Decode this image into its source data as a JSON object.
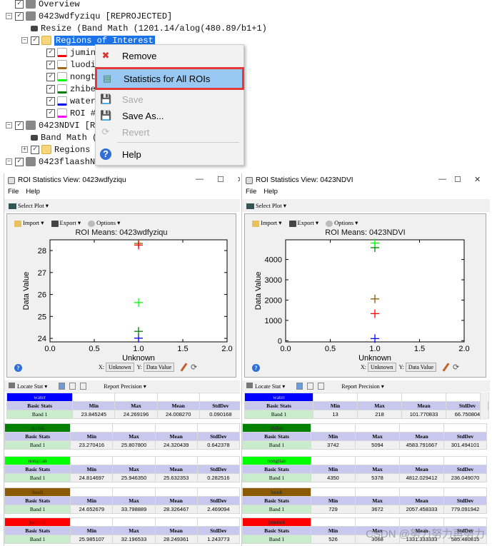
{
  "tree": {
    "items": [
      {
        "label": "Overview",
        "indent": 0,
        "icon": "raster-icon",
        "expander": "",
        "checked": true
      },
      {
        "label": "0423wdfyziqu [REPROJECTED]",
        "indent": 0,
        "icon": "raster-icon",
        "expander": "-",
        "checked": true
      },
      {
        "label": "Resize (Band Math (1201.14/alog(480.89/b1+1)",
        "indent": 1,
        "icon": "band-icon",
        "expander": "",
        "checked": false
      },
      {
        "label": "Regions of Interest",
        "indent": 1,
        "icon": "folder-icon",
        "expander": "-",
        "checked": true,
        "selected": true
      },
      {
        "label": "jumindi",
        "indent": 2,
        "icon": "roi-icon",
        "color": "#ff0000",
        "checked": true
      },
      {
        "label": "luodi",
        "indent": 2,
        "icon": "roi-icon",
        "color": "#a0661a",
        "checked": true
      },
      {
        "label": "nongtian",
        "indent": 2,
        "icon": "roi-icon",
        "color": "#00ff00",
        "checked": true
      },
      {
        "label": "zhibei",
        "indent": 2,
        "icon": "roi-icon",
        "color": "#008000",
        "checked": true
      },
      {
        "label": "water",
        "indent": 2,
        "icon": "roi-icon",
        "color": "#0000ff",
        "checked": true
      },
      {
        "label": "ROI #",
        "indent": 2,
        "icon": "roi-icon",
        "color": "#ff00ff",
        "checked": true
      },
      {
        "label": "0423NDVI [R",
        "indent": 0,
        "icon": "raster-icon",
        "expander": "-",
        "checked": true
      },
      {
        "label": "Band Math (",
        "indent": 1,
        "icon": "band-icon",
        "expander": "",
        "checked": false
      },
      {
        "label": "Regions",
        "indent": 1,
        "icon": "folder-icon",
        "expander": "+",
        "checked": true
      },
      {
        "label": "0423flaashN",
        "indent": 0,
        "icon": "raster-icon",
        "expander": "-",
        "checked": true
      }
    ]
  },
  "context_menu": {
    "items": [
      {
        "label": "Remove",
        "icon": "remove-icon",
        "disabled": false
      },
      {
        "label": "Statistics for All ROIs",
        "icon": "statistics-icon",
        "disabled": false,
        "highlighted": true
      },
      {
        "label": "Save",
        "icon": "save-icon",
        "disabled": true
      },
      {
        "label": "Save As...",
        "icon": "save-as-icon",
        "disabled": false
      },
      {
        "label": "Revert",
        "icon": "revert-icon",
        "disabled": true
      },
      {
        "label": "Help",
        "icon": "help-icon",
        "disabled": false
      }
    ],
    "highlight_color": "#e53935"
  },
  "windows": [
    {
      "title": "ROI Statistics View: 0423wdfyziqu",
      "menu": [
        "File",
        "Help"
      ],
      "select_plot": "Select Plot",
      "plot_toolbar": [
        "Import",
        "Export",
        "Options"
      ],
      "x_select": "Unknown",
      "y_select": "Data Value",
      "x_label_prefix": "X:",
      "y_label_prefix": "Y:",
      "locate_stat": "Locate Stat",
      "report_precision": "Report Precision",
      "chart": {
        "type": "scatter",
        "title": "ROI Means: 0423wdfyziqu",
        "xlabel": "Unknown",
        "ylabel": "Data Value",
        "xlim": [
          0,
          2
        ],
        "ylim": [
          23.84,
          28.49
        ],
        "xticks": [
          "0.0",
          "0.5",
          "1.0",
          "1.5",
          "2.0"
        ],
        "yticks": [
          24,
          25,
          26,
          27,
          28
        ]
      },
      "rois": [
        {
          "name": "water",
          "color": "#0000ff",
          "min": "23.845245",
          "max": "24.269196",
          "mean": "24.008270",
          "stddev": "0.090168"
        },
        {
          "name": "zhibei",
          "color": "#008000",
          "min": "23.270416",
          "max": "25.807800",
          "mean": "24.320439",
          "stddev": "0.642378"
        },
        {
          "name": "nongtian",
          "color": "#00ff00",
          "min": "24.814697",
          "max": "25.946350",
          "mean": "25.632353",
          "stddev": "0.282516"
        },
        {
          "name": "luodi",
          "color": "#8b5a00",
          "min": "24.652679",
          "max": "33.798889",
          "mean": "28.326467",
          "stddev": "2.469094"
        },
        {
          "name": "jumindi",
          "color": "#ff0000",
          "min": "25.985107",
          "max": "32.196533",
          "mean": "28.249361",
          "stddev": "1.243773"
        }
      ]
    },
    {
      "title": "ROI Statistics View: 0423NDVI",
      "menu": [
        "File",
        "Help"
      ],
      "select_plot": "Select Plot",
      "plot_toolbar": [
        "Import",
        "Export",
        "Options"
      ],
      "x_select": "Unknown",
      "y_select": "Data Value",
      "x_label_prefix": "X:",
      "y_label_prefix": "Y:",
      "locate_stat": "Locate Stat",
      "report_precision": "Report Precision",
      "chart": {
        "type": "scatter",
        "title": "ROI Means: 0423NDVI",
        "xlabel": "Unknown",
        "ylabel": "Data Value",
        "xlim": [
          0,
          2
        ],
        "ylim": [
          -60,
          4970
        ],
        "xticks": [
          "0.0",
          "0.5",
          "1.0",
          "1.5",
          "2.0"
        ],
        "yticks": [
          0,
          1000,
          2000,
          3000,
          4000
        ]
      },
      "rois": [
        {
          "name": "water",
          "color": "#0000ff",
          "min": "13",
          "max": "218",
          "mean": "101.770833",
          "stddev": "66.750804"
        },
        {
          "name": "zhibei",
          "color": "#008000",
          "min": "3742",
          "max": "5094",
          "mean": "4583.791667",
          "stddev": "301.494101"
        },
        {
          "name": "nongtian",
          "color": "#00ff00",
          "min": "4350",
          "max": "5378",
          "mean": "4812.029412",
          "stddev": "236.049070"
        },
        {
          "name": "luodi",
          "color": "#8b5a00",
          "min": "729",
          "max": "3672",
          "mean": "2057.458333",
          "stddev": "779.091942"
        },
        {
          "name": "jumindi",
          "color": "#ff0000",
          "min": "526",
          "max": "3068",
          "mean": "1331.333333",
          "stddev": "585.480815"
        }
      ]
    }
  ],
  "table_headers": {
    "basic": "Basic Stats",
    "band": "Band 1",
    "min": "Min",
    "max": "Max",
    "mean": "Mean",
    "stddev": "StdDev"
  },
  "watermark": "CSDN @努力努力再努力"
}
